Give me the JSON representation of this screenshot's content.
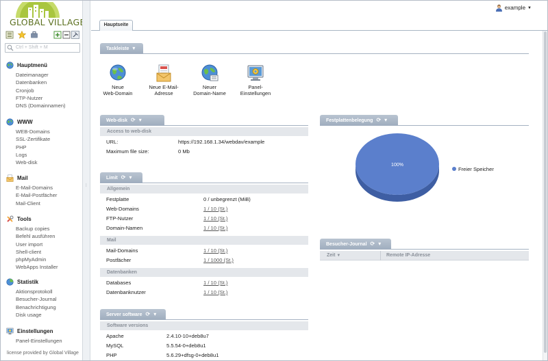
{
  "brand": {
    "name": "GLOBAL VILLAGE"
  },
  "search": {
    "placeholder": "Ctrl + Shift + M"
  },
  "sidebar": {
    "sections": [
      {
        "title": "Hauptmenü",
        "icon": "globe-icon",
        "items": [
          "Dateimanager",
          "Datenbanken",
          "Cronjob",
          "FTP-Nutzer",
          "DNS (Domainnamen)"
        ]
      },
      {
        "title": "WWW",
        "icon": "globe-icon",
        "items": [
          "WEB-Domains",
          "SSL-Zertifikate",
          "PHP",
          "Logs",
          "Web-disk"
        ]
      },
      {
        "title": "Mail",
        "icon": "mail-icon",
        "items": [
          "E-Mail-Domains",
          "E-Mail-Postfächer",
          "Mail-Client"
        ]
      },
      {
        "title": "Tools",
        "icon": "tools-icon",
        "items": [
          "Backup copies",
          "Befehl ausführen",
          "User import",
          "Shell-client",
          "phpMyAdmin",
          "WebApps Installer"
        ]
      },
      {
        "title": "Statistik",
        "icon": "chart-icon",
        "items": [
          "Aktionsprotokoll",
          "Besucher-Journal",
          "Benachrichtigung",
          "Disk usage"
        ]
      },
      {
        "title": "Einstellungen",
        "icon": "settings-icon",
        "items": [
          "Panel-Einstellungen"
        ]
      }
    ],
    "license": "license provided by Global Village"
  },
  "header": {
    "tab": "Hauptseite",
    "user": "example"
  },
  "taskleiste": {
    "title": "Taskleiste",
    "launchers": [
      {
        "line1": "Neue",
        "line2": "Web-Domain",
        "icon": "globe-icon"
      },
      {
        "line1": "Neue E-Mail-",
        "line2": "Adresse",
        "icon": "mail-icon"
      },
      {
        "line1": "Neuer",
        "line2": "Domain-Name",
        "icon": "globe-icon"
      },
      {
        "line1": "Panel-",
        "line2": "Einstellungen",
        "icon": "settings-icon"
      }
    ]
  },
  "webdisk": {
    "title": "Web-disk",
    "subtitle": "Access to web-disk",
    "rows": [
      {
        "label": "URL:",
        "value": "https://192.168.1.34/webdav/example"
      },
      {
        "label": "Maximum file size:",
        "value": "0 Mb"
      }
    ]
  },
  "limit": {
    "title": "Limit",
    "groups": [
      {
        "name": "Allgemein",
        "rows": [
          {
            "label": "Festplatte",
            "value": "0 / unbegrenzt (MiB)",
            "link": false
          },
          {
            "label": "Web-Domains",
            "value": "1 / 10 (St.)",
            "link": true
          },
          {
            "label": "FTP-Nutzer",
            "value": "1 / 10 (St.)",
            "link": true
          },
          {
            "label": "Domain-Namen",
            "value": "1 / 10 (St.)",
            "link": true
          }
        ]
      },
      {
        "name": "Mail",
        "rows": [
          {
            "label": "Mail-Domains",
            "value": "1 / 10 (St.)",
            "link": true
          },
          {
            "label": "Postfächer",
            "value": "1 / 1000 (St.)",
            "link": true
          }
        ]
      },
      {
        "name": "Datenbanken",
        "rows": [
          {
            "label": "Databases",
            "value": "1 / 10 (St.)",
            "link": true
          },
          {
            "label": "Datenbanknutzer",
            "value": "1 / 10 (St.)",
            "link": true
          }
        ]
      }
    ]
  },
  "server": {
    "title": "Server software",
    "subtitle": "Software versions",
    "rows": [
      {
        "label": "Apache",
        "value": "2.4.10-10+deb8u7"
      },
      {
        "label": "MySQL",
        "value": "5.5.54-0+deb8u1"
      },
      {
        "label": "PHP",
        "value": "5.6.29+dfsg-0+deb8u1"
      }
    ]
  },
  "disk": {
    "title": "Festplattenbelegung",
    "slice_label": "100%",
    "legend": "Freier Speicher",
    "color": "#5b7fcc"
  },
  "journal": {
    "title": "Besucher-Journal",
    "col_time": "Zeit",
    "col_ip": "Remote IP-Adresse"
  },
  "chart_data": {
    "type": "pie",
    "categories": [
      "Freier Speicher"
    ],
    "values": [
      100
    ],
    "title": "Festplattenbelegung",
    "data_labels": [
      "100%"
    ],
    "legend_placement": "right"
  }
}
